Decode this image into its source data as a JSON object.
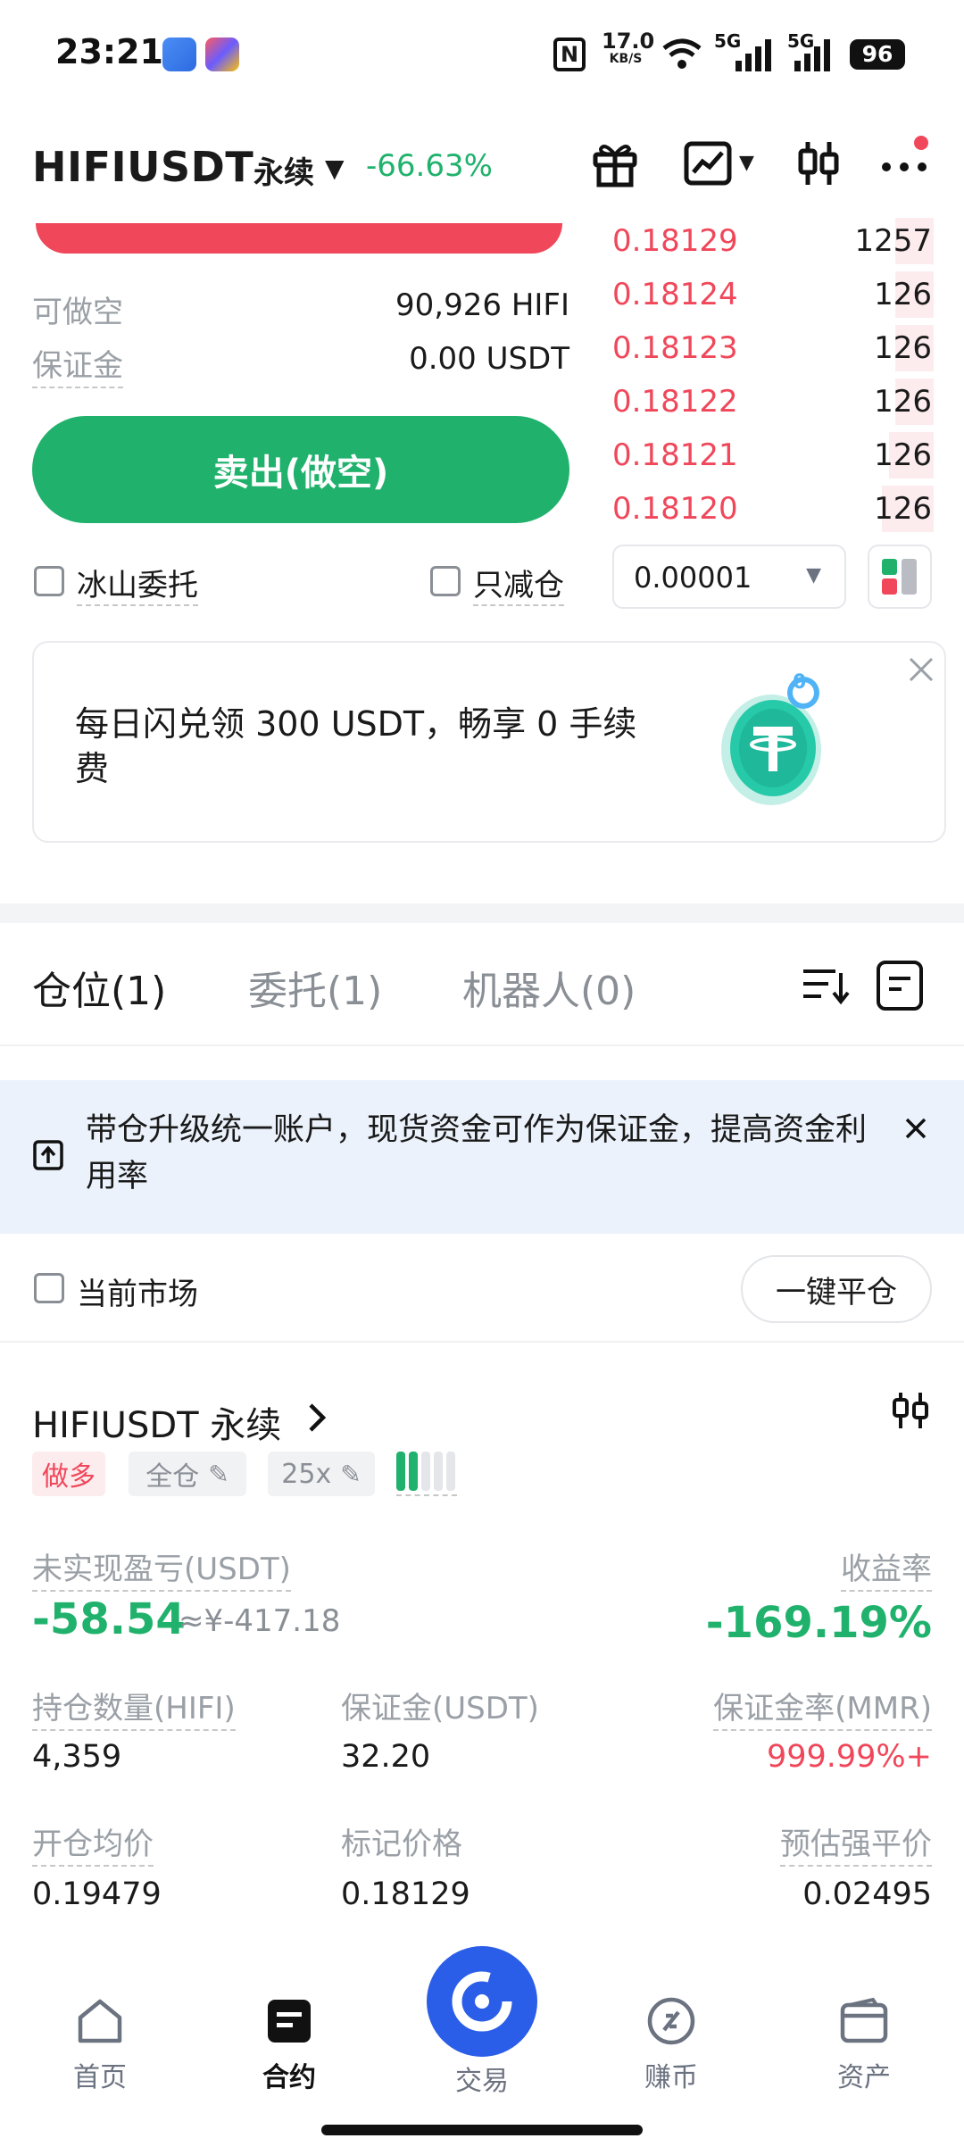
{
  "status_bar": {
    "time": "23:21",
    "net_speed_value": "17.0",
    "net_speed_unit": "KB/S",
    "signal1": "5G",
    "signal2": "5G",
    "battery": "96"
  },
  "header": {
    "symbol": "HIFIUSDT",
    "contract_type": "永续",
    "change_pct": "-66.63%"
  },
  "order_form": {
    "available_short_label": "可做空",
    "available_short_value": "90,926 HIFI",
    "margin_label": "保证金",
    "margin_value": "0.00 USDT",
    "sell_button": "卖出(做空)",
    "iceberg_label": "冰山委托",
    "reduce_only_label": "只减仓"
  },
  "order_book": {
    "asks": [
      {
        "price": "0.18129",
        "size": "1257",
        "depth": 0.12
      },
      {
        "price": "0.18124",
        "size": "126",
        "depth": 0.12
      },
      {
        "price": "0.18123",
        "size": "126",
        "depth": 0.12
      },
      {
        "price": "0.18122",
        "size": "126",
        "depth": 0.12
      },
      {
        "price": "0.18121",
        "size": "126",
        "depth": 0.14
      },
      {
        "price": "0.18120",
        "size": "126",
        "depth": 0.16
      }
    ],
    "precision": "0.00001"
  },
  "promo": {
    "text": "每日闪兑领 300 USDT，畅享 0 手续费",
    "badge": "0"
  },
  "tabs": [
    {
      "label": "仓位(1)"
    },
    {
      "label": "委托(1)"
    },
    {
      "label": "机器人(0)"
    }
  ],
  "banner": {
    "text": "带仓升级统一账户，现货资金可作为保证金，提高资金利用率"
  },
  "filters": {
    "current_market_label": "当前市场",
    "close_all_button": "一键平仓"
  },
  "position": {
    "title": "HIFIUSDT 永续",
    "side_tag": "做多",
    "margin_mode_tag": "全仓",
    "leverage_tag": "25x",
    "unrealized_pnl_label": "未实现盈亏(USDT)",
    "unrealized_pnl_value": "-58.54",
    "unrealized_pnl_cny": "≈¥-417.18",
    "roe_label": "收益率",
    "roe_value": "-169.19%",
    "size_label": "持仓数量(HIFI)",
    "size_value": "4,359",
    "margin_label": "保证金(USDT)",
    "margin_value": "32.20",
    "mmr_label": "保证金率(MMR)",
    "mmr_value": "999.99%+",
    "entry_label": "开仓均价",
    "entry_value": "0.19479",
    "mark_label": "标记价格",
    "mark_value": "0.18129",
    "liq_label": "预估强平价",
    "liq_value": "0.02495"
  },
  "nav": [
    {
      "label": "首页",
      "icon": "home-icon"
    },
    {
      "label": "合约",
      "icon": "futures-icon"
    },
    {
      "label": "交易",
      "icon": "trade-icon"
    },
    {
      "label": "赚币",
      "icon": "earn-icon"
    },
    {
      "label": "资产",
      "icon": "wallet-icon"
    }
  ],
  "colors": {
    "green": "#20b26c",
    "red": "#f0475a",
    "blue": "#2b5ee8"
  }
}
